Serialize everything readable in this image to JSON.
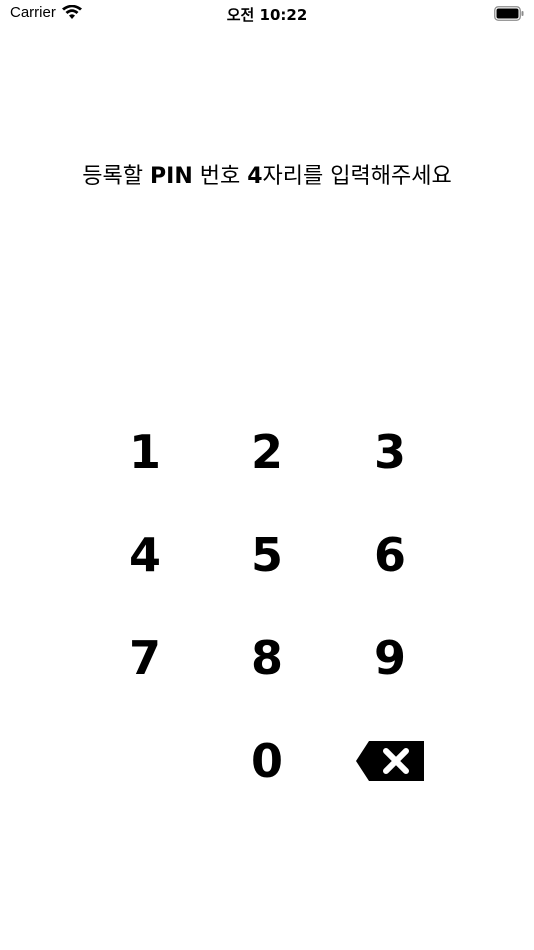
{
  "status_bar": {
    "carrier": "Carrier",
    "time": "오전 10:22"
  },
  "prompt": {
    "part1": "등록할 ",
    "bold1": "PIN",
    "part2": " 번호 ",
    "bold2": "4",
    "part3": "자리를 입력해주세요"
  },
  "keypad": {
    "keys": [
      "1",
      "2",
      "3",
      "4",
      "5",
      "6",
      "7",
      "8",
      "9",
      "",
      "0",
      "backspace-icon"
    ]
  },
  "colors": {
    "background": "#ffffff",
    "text": "#000000"
  }
}
